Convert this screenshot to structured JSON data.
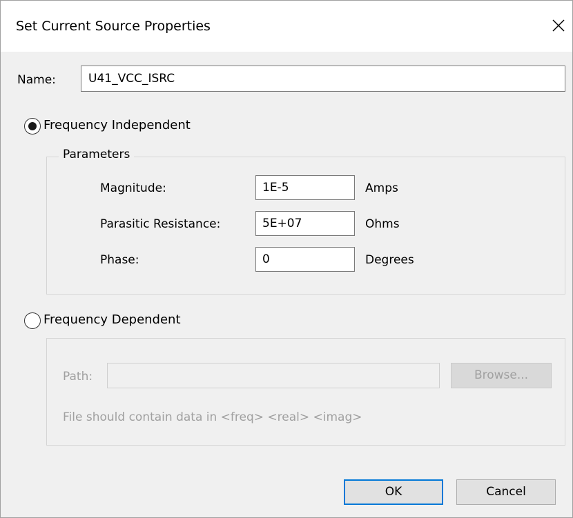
{
  "dialog": {
    "title": "Set Current Source Properties"
  },
  "name_field": {
    "label": "Name:",
    "value": "U41_VCC_ISRC"
  },
  "freq_independent": {
    "label": "Frequency Independent",
    "selected": true,
    "group_title": "Parameters",
    "params": [
      {
        "label": "Magnitude:",
        "value": "1E-5",
        "unit": "Amps"
      },
      {
        "label": "Parasitic Resistance:",
        "value": "5E+07",
        "unit": "Ohms"
      },
      {
        "label": "Phase:",
        "value": "0",
        "unit": "Degrees"
      }
    ]
  },
  "freq_dependent": {
    "label": "Frequency Dependent",
    "selected": false,
    "path_label": "Path:",
    "path_value": "",
    "browse_label": "Browse...",
    "hint": "File should contain data in <freq> <real> <imag>"
  },
  "buttons": {
    "ok_label": "OK",
    "cancel_label": "Cancel"
  },
  "icons": {
    "close": "close-icon"
  },
  "colors": {
    "accent": "#0078d7",
    "background": "#f0f0f0"
  }
}
